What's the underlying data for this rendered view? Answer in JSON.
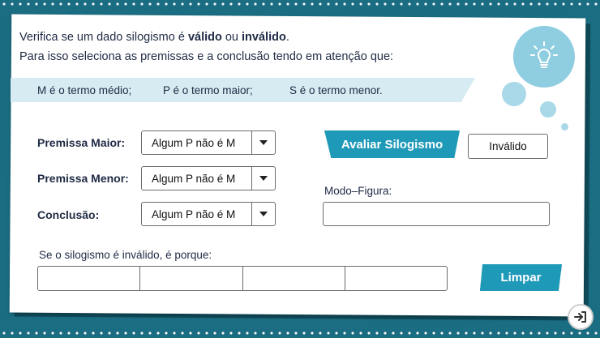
{
  "intro": {
    "line1_prefix": "Verifica se um dado silogismo é ",
    "line1_valid": "válido",
    "line1_or": " ou ",
    "line1_invalid": "inválido",
    "line1_suffix": ".",
    "line2": "Para isso seleciona as premissas e a conclusão tendo em atenção que:"
  },
  "terms": {
    "m": "M é o termo médio;",
    "p": "P é o termo maior;",
    "s": "S é o termo menor."
  },
  "form": {
    "premissa_maior": {
      "label": "Premissa Maior:",
      "value": "Algum P não é M"
    },
    "premissa_menor": {
      "label": "Premissa Menor:",
      "value": "Algum P não é M"
    },
    "conclusao": {
      "label": "Conclusão:",
      "value": "Algum P não é M"
    }
  },
  "evaluate": {
    "button_label": "Avaliar Silogismo",
    "result": "Inválido"
  },
  "modo_figura": {
    "label": "Modo–Figura:",
    "value": ""
  },
  "reason": {
    "label": "Se o silogismo é inválido, é porque:",
    "cells": [
      "",
      "",
      "",
      ""
    ]
  },
  "clear_button_label": "Limpar",
  "icons": {
    "lightbulb": "lightbulb-icon",
    "dropdown": "chevron-down-icon",
    "exit": "exit-icon"
  },
  "colors": {
    "background": "#1b6d82",
    "accent": "#1f99b8",
    "band": "#d7ebf2",
    "text": "#1f2a44"
  }
}
